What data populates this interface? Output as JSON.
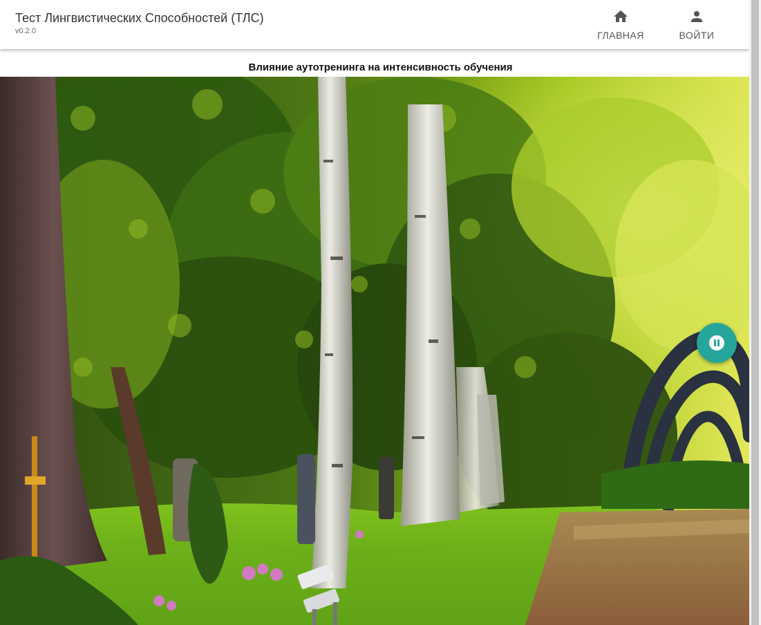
{
  "app": {
    "title": "Тест Лингвистических Способностей (ТЛС)",
    "version": "v0.2.0"
  },
  "nav": {
    "home_label": "ГЛАВНАЯ",
    "login_label": "ВОЙТИ"
  },
  "content": {
    "heading": "Влияние аутотренинга на интенсивность обучения"
  },
  "player": {
    "state": "playing",
    "control_icon": "pause-icon"
  },
  "colors": {
    "accent": "#26a69a",
    "nav_text": "#555555"
  }
}
